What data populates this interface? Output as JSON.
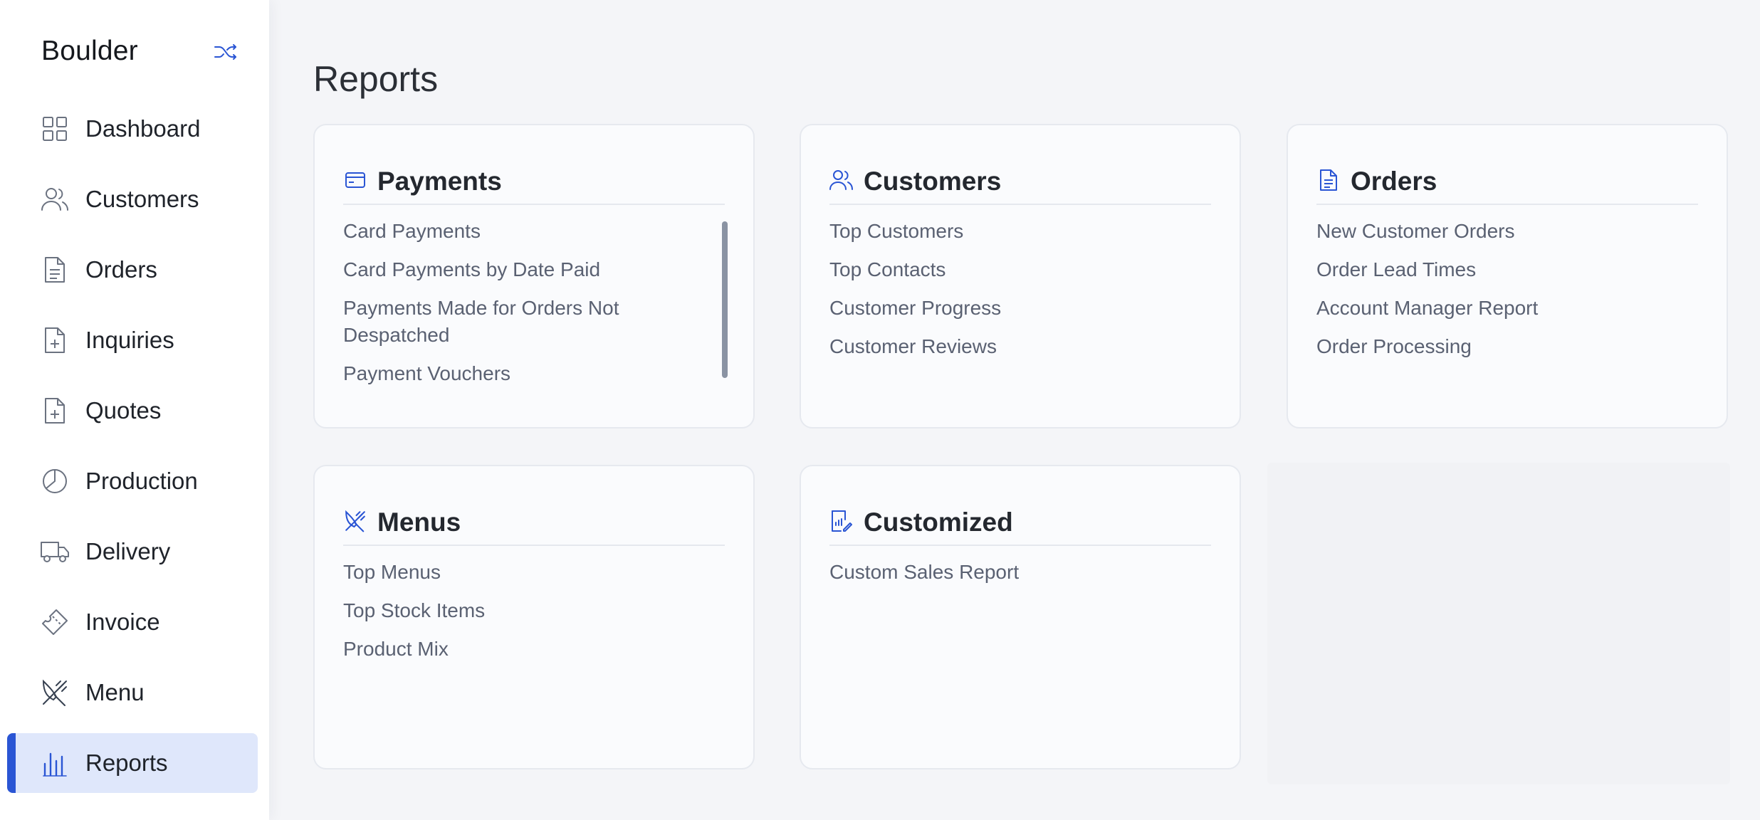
{
  "sidebar": {
    "brand": "Boulder",
    "items": [
      {
        "label": "Dashboard",
        "icon": "grid-icon"
      },
      {
        "label": "Customers",
        "icon": "users-icon"
      },
      {
        "label": "Orders",
        "icon": "document-icon"
      },
      {
        "label": "Inquiries",
        "icon": "file-plus-icon"
      },
      {
        "label": "Quotes",
        "icon": "file-plus-icon"
      },
      {
        "label": "Production",
        "icon": "pie-chart-icon"
      },
      {
        "label": "Delivery",
        "icon": "truck-icon"
      },
      {
        "label": "Invoice",
        "icon": "ticket-icon"
      },
      {
        "label": "Menu",
        "icon": "utensils-icon"
      },
      {
        "label": "Reports",
        "icon": "bar-chart-icon",
        "active": true
      }
    ]
  },
  "page": {
    "title": "Reports"
  },
  "cards": [
    {
      "title": "Payments",
      "icon": "credit-card-icon",
      "links": [
        "Card Payments",
        "Card Payments by Date Paid",
        "Payments Made for Orders Not Despatched",
        "Payment Vouchers"
      ]
    },
    {
      "title": "Customers",
      "icon": "users-icon",
      "links": [
        "Top Customers",
        "Top Contacts",
        "Customer Progress",
        "Customer Reviews"
      ]
    },
    {
      "title": "Orders",
      "icon": "document-icon",
      "links": [
        "New Customer Orders",
        "Order Lead Times",
        "Account Manager Report",
        "Order Processing"
      ]
    },
    {
      "title": "Menus",
      "icon": "utensils-icon",
      "links": [
        "Top Menus",
        "Top Stock Items",
        "Product Mix"
      ]
    },
    {
      "title": "Customized",
      "icon": "custom-report-icon",
      "links": [
        "Custom Sales Report"
      ]
    }
  ],
  "colors": {
    "accent": "#2a55d4",
    "active_bg": "#dfe7fb",
    "link": "#5a6172",
    "card_border": "#e6e9ef"
  }
}
